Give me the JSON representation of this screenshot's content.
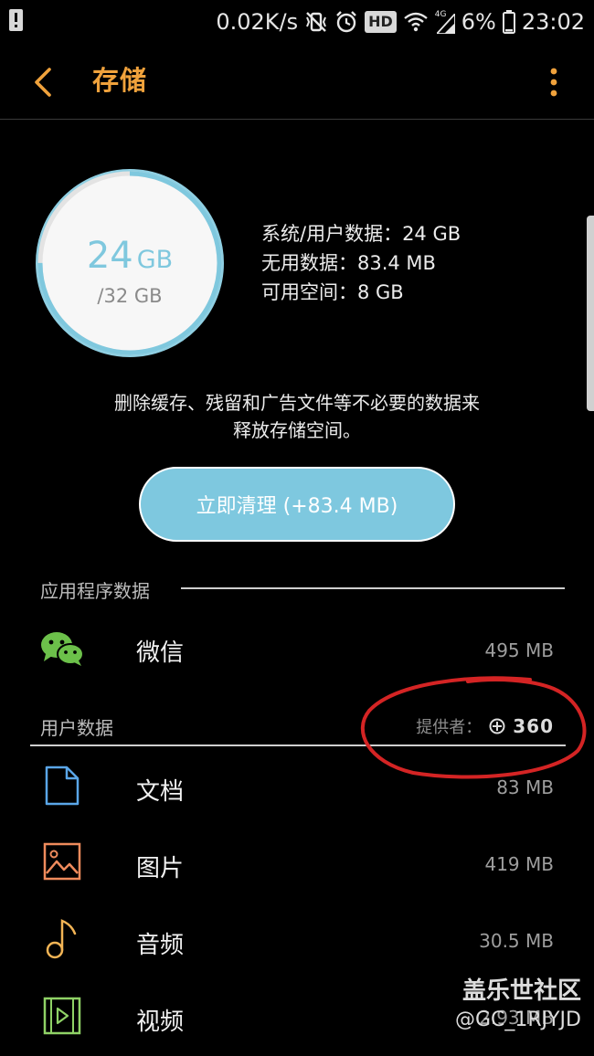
{
  "status_bar": {
    "network_speed": "0.02K/s",
    "hd_badge": "HD",
    "network_type": "4G",
    "battery": "6%",
    "time": "23:02"
  },
  "header": {
    "title": "存储"
  },
  "storage": {
    "used_value": "24",
    "used_unit": "GB",
    "total": "/32 GB",
    "used_fraction": 0.75,
    "stats": {
      "system_user": "系统/用户数据：24 GB",
      "junk": "无用数据：83.4 MB",
      "available": "可用空间：8 GB"
    },
    "description_line1": "删除缓存、残留和广告文件等不必要的数据来",
    "description_line2": "释放存储空间。",
    "cleanup_label": "立即清理 (+83.4 MB)"
  },
  "app_data": {
    "section_title": "应用程序数据",
    "items": [
      {
        "label": "微信",
        "size": "495 MB",
        "icon": "wechat-icon"
      }
    ]
  },
  "user_data": {
    "section_title": "用户数据",
    "provider_label": "提供者：",
    "provider_name": "360",
    "items": [
      {
        "label": "文档",
        "size": "83 MB",
        "icon": "document-icon"
      },
      {
        "label": "图片",
        "size": "419 MB",
        "icon": "image-icon"
      },
      {
        "label": "音频",
        "size": "30.5 MB",
        "icon": "music-note-icon"
      },
      {
        "label": "视频",
        "size": "2.93 MB",
        "icon": "video-icon"
      }
    ]
  },
  "watermark": {
    "line1": "盖乐世社区",
    "line2": "@GC_1RJYJD"
  },
  "colors": {
    "accent": "#f0a23c",
    "ring": "#7fc8de",
    "button": "#7ec8df",
    "annotation": "#d42424",
    "wechat": "#6cc04a",
    "document": "#5aa6e8",
    "image": "#ef8b5c",
    "music": "#f2b455",
    "video": "#8fd266"
  }
}
